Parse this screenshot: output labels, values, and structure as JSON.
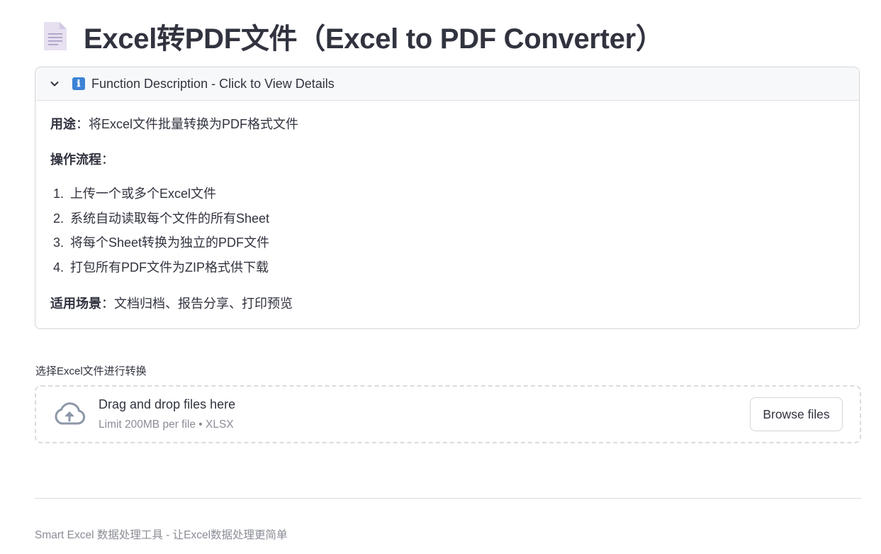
{
  "header": {
    "icon": "document-icon",
    "title": "Excel转PDF文件（Excel to PDF Converter）"
  },
  "expander": {
    "expanded": true,
    "chevron": "chevron-down-icon",
    "info_icon": "ℹ",
    "label": "Function Description - Click to View Details",
    "purpose_label": "用途",
    "purpose_text": "：将Excel文件批量转换为PDF格式文件",
    "process_label": "操作流程",
    "process_suffix": "：",
    "steps": [
      {
        "num": "1.",
        "text": "上传一个或多个Excel文件"
      },
      {
        "num": "2.",
        "text": "系统自动读取每个文件的所有Sheet"
      },
      {
        "num": "3.",
        "text": "将每个Sheet转换为独立的PDF文件"
      },
      {
        "num": "4.",
        "text": "打包所有PDF文件为ZIP格式供下载"
      }
    ],
    "scenario_label": "适用场景",
    "scenario_text": "：文档归档、报告分享、打印预览"
  },
  "uploader": {
    "label": "选择Excel文件进行转换",
    "drag_text": "Drag and drop files here",
    "limit_text": "Limit 200MB per file • XLSX",
    "browse_label": "Browse files",
    "icon": "cloud-upload-icon"
  },
  "footer": {
    "text": "Smart Excel 数据处理工具 - 让Excel数据处理更简单"
  },
  "colors": {
    "text": "#31333f",
    "muted": "#8b8d96",
    "info_blue": "#3b82d6",
    "border": "#d6d6d9"
  }
}
